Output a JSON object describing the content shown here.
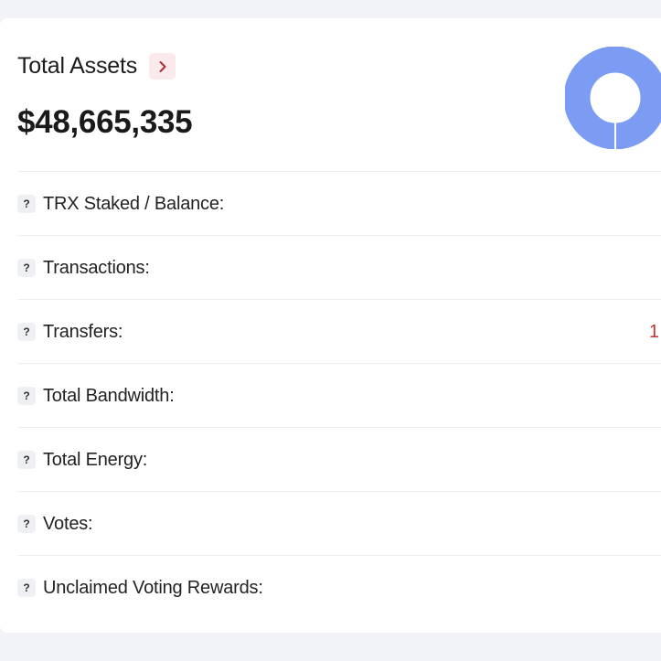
{
  "header": {
    "title": "Total Assets",
    "total_value": "$48,665,335"
  },
  "colors": {
    "accent_red": "#c23631",
    "donut_blue": "#7b9cf2",
    "chevron_bg": "#fbeaec"
  },
  "rows": [
    {
      "label": "TRX Staked / Balance:",
      "value": ""
    },
    {
      "label": "Transactions:",
      "value": ""
    },
    {
      "label": "Transfers:",
      "value": "1"
    },
    {
      "label": "Total Bandwidth:",
      "value": ""
    },
    {
      "label": "Total Energy:",
      "value": ""
    },
    {
      "label": "Votes:",
      "value": ""
    },
    {
      "label": "Unclaimed Voting Rewards:",
      "value": ""
    }
  ],
  "icons": {
    "help": "question-mark-icon",
    "chevron": "chevron-right-icon"
  },
  "help_glyph": "?"
}
